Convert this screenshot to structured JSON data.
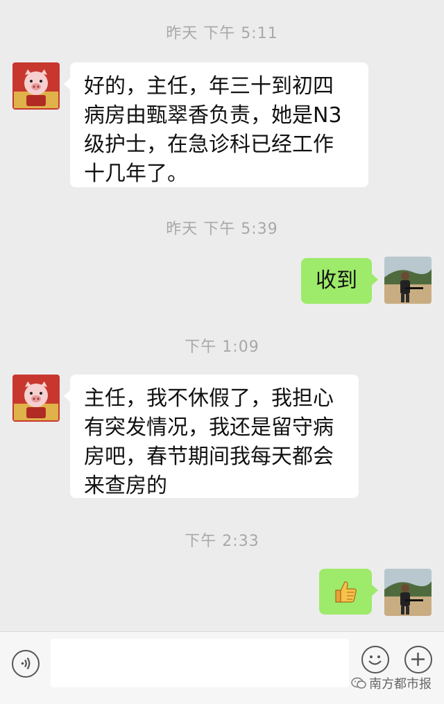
{
  "messages": [
    {
      "type": "time",
      "text": "昨天 下午 5:11"
    },
    {
      "type": "incoming",
      "lines": [
        "好的，主任，年三十到初四",
        "病房由甄翠香负责，她是N3",
        "级护士，在急诊科已经工作",
        "十几年了。"
      ]
    },
    {
      "type": "time",
      "text": "昨天 下午 5:39"
    },
    {
      "type": "outgoing",
      "text": "收到"
    },
    {
      "type": "time",
      "text": "下午 1:09"
    },
    {
      "type": "incoming",
      "lines": [
        "主任，我不休假了，我担心",
        "有突发情况，我还是留守病",
        "房吧，春节期间我每天都会",
        "来查房的"
      ]
    },
    {
      "type": "time",
      "text": "下午 2:33"
    },
    {
      "type": "outgoing_emoji",
      "icon": "thumbs-up-emoji"
    }
  ],
  "watermark": {
    "text": "南方都市报"
  },
  "colors": {
    "background": "#ececec",
    "incoming_bubble": "#ffffff",
    "outgoing_bubble": "#9eea6a"
  }
}
